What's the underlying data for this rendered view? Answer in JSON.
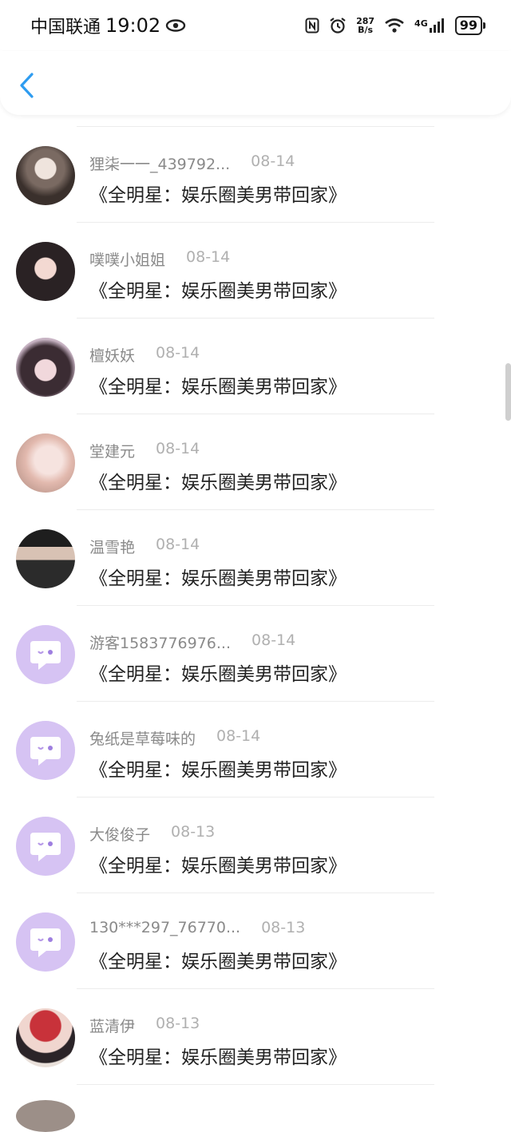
{
  "status": {
    "carrier": "中国联通",
    "time": "19:02",
    "speed_top": "287",
    "speed_bottom": "B/s",
    "network": "4G",
    "battery": "99"
  },
  "colors": {
    "accent": "#2e9cf0",
    "placeholder_avatar": "#d6c3f3"
  },
  "comments": [
    {
      "name": "狸柒一一_439792...",
      "date": "08-14",
      "text": "《全明星：娱乐圈美男带回家》",
      "avatar": "photo"
    },
    {
      "name": "噗噗小姐姐",
      "date": "08-14",
      "text": "《全明星：娱乐圈美男带回家》",
      "avatar": "photo"
    },
    {
      "name": "檀妖妖",
      "date": "08-14",
      "text": "《全明星：娱乐圈美男带回家》",
      "avatar": "photo"
    },
    {
      "name": "堂建元",
      "date": "08-14",
      "text": "《全明星：娱乐圈美男带回家》",
      "avatar": "photo"
    },
    {
      "name": "温雪艳",
      "date": "08-14",
      "text": "《全明星：娱乐圈美男带回家》",
      "avatar": "photo"
    },
    {
      "name": "游客1583776976...",
      "date": "08-14",
      "text": "《全明星：娱乐圈美男带回家》",
      "avatar": "chat-bubble-icon"
    },
    {
      "name": "兔纸是草莓味的",
      "date": "08-14",
      "text": "《全明星：娱乐圈美男带回家》",
      "avatar": "chat-bubble-icon"
    },
    {
      "name": "大俊俊子",
      "date": "08-13",
      "text": "《全明星：娱乐圈美男带回家》",
      "avatar": "chat-bubble-icon"
    },
    {
      "name": "130***297_76770...",
      "date": "08-13",
      "text": "《全明星：娱乐圈美男带回家》",
      "avatar": "chat-bubble-icon"
    },
    {
      "name": "蓝清伊",
      "date": "08-13",
      "text": "《全明星：娱乐圈美男带回家》",
      "avatar": "photo"
    }
  ]
}
